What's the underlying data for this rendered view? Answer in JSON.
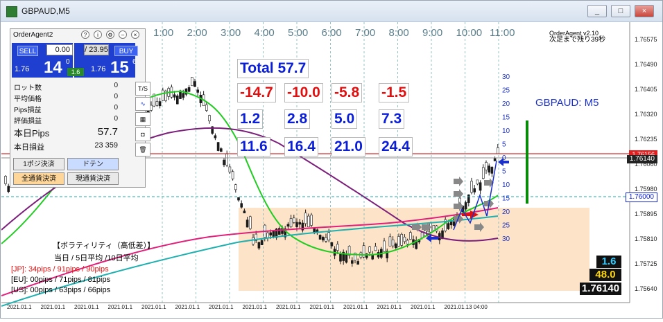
{
  "window": {
    "title": "GBPAUD,M5",
    "buttons": [
      "_",
      "□",
      "×"
    ]
  },
  "chart": {
    "time_labels": [
      "1:00",
      "2:00",
      "3:00",
      "4:00",
      "5:00",
      "6:00",
      "7:00",
      "8:00",
      "9:00",
      "10:00",
      "11:00"
    ],
    "price_labels": [
      "1.76575",
      "1.76490",
      "1.76405",
      "1.76320",
      "1.76235",
      "1.76060",
      "1.75980",
      "1.75895",
      "1.75810",
      "1.75725",
      "1.75640"
    ],
    "date_labels": [
      "2021.01.1",
      "2021.01.1",
      "2021.01.1",
      "2021.01.1",
      "2021.01.1",
      "2021.01.1",
      "2021.01.1",
      "2021.01.1",
      "2021.01.1",
      "2021.01.1",
      "2021.01.1",
      "2021.01.1",
      "2021.01.1",
      "2021.01.13 04:00"
    ],
    "header_right": "OrderAgent v2.10",
    "header_right2": "次足まで残り39秒",
    "symbol_label": "GBPAUD: M5",
    "tag_red": "1.76156",
    "tag_current": "1.76140",
    "tag_level": "1.76000",
    "scale_labels": [
      "30",
      "25",
      "20",
      "15",
      "10",
      "5",
      "0",
      "5",
      "10",
      "15",
      "20",
      "25",
      "30"
    ]
  },
  "stats": {
    "total": "Total 57.7",
    "row_red": [
      "-14.7",
      "-10.0",
      "-5.8",
      "-1.5"
    ],
    "row_blue1": [
      "1.2",
      "2.8",
      "5.0",
      "7.3"
    ],
    "row_blue2": [
      "11.6",
      "16.4",
      "21.0",
      "24.4"
    ]
  },
  "panel": {
    "title": "OrderAgent2",
    "sell_label": "SELL",
    "buy_label": "BUY",
    "lot_value": "0.00",
    "lot_max": "/ 23.95",
    "sell_price_prefix": "1.76",
    "sell_price_main": "14",
    "sell_price_sup": "0",
    "buy_price_prefix": "1.76",
    "buy_price_main": "15",
    "buy_price_sup": "6",
    "spread": "1.6",
    "rows": [
      {
        "label": "ロット数",
        "value": "0"
      },
      {
        "label": "平均価格",
        "value": "0"
      },
      {
        "label": "Pips損益",
        "value": "0"
      },
      {
        "label": "評価損益",
        "value": "0"
      }
    ],
    "today_pips_label": "本日Pips",
    "today_pips_value": "57.7",
    "today_pl_label": "本日損益",
    "today_pl_value": "23 359",
    "btn_close_one": "1ポジ決済",
    "btn_doten": "ドテン",
    "btn_close_all": "全通貨決済",
    "btn_close_symbol": "現通貨決済",
    "side_ts": "T/S"
  },
  "volatility": {
    "title": "【ボラティリティ（高低差）】",
    "header": "当日 / 5日平均 /10日平均",
    "jp": "[JP]:  34pips /  91pips /  90pips",
    "eu": "[EU]:   00pips /  71pips /  81pips",
    "us": "[US]:   00pips /  63pips /  66pips"
  },
  "bottom_right": {
    "v1": "1.6",
    "v2": "48.0",
    "v3": "1.76140"
  },
  "colors": {
    "sell_blue": "#1e3fd0",
    "green_ma": "#22cc22",
    "purple_ma": "#7b1f7b",
    "cyan_ma": "#20b0b0",
    "pink_ma": "#e0207a",
    "range_fill": "#fde3c8",
    "bull": "#1a1a1a"
  }
}
